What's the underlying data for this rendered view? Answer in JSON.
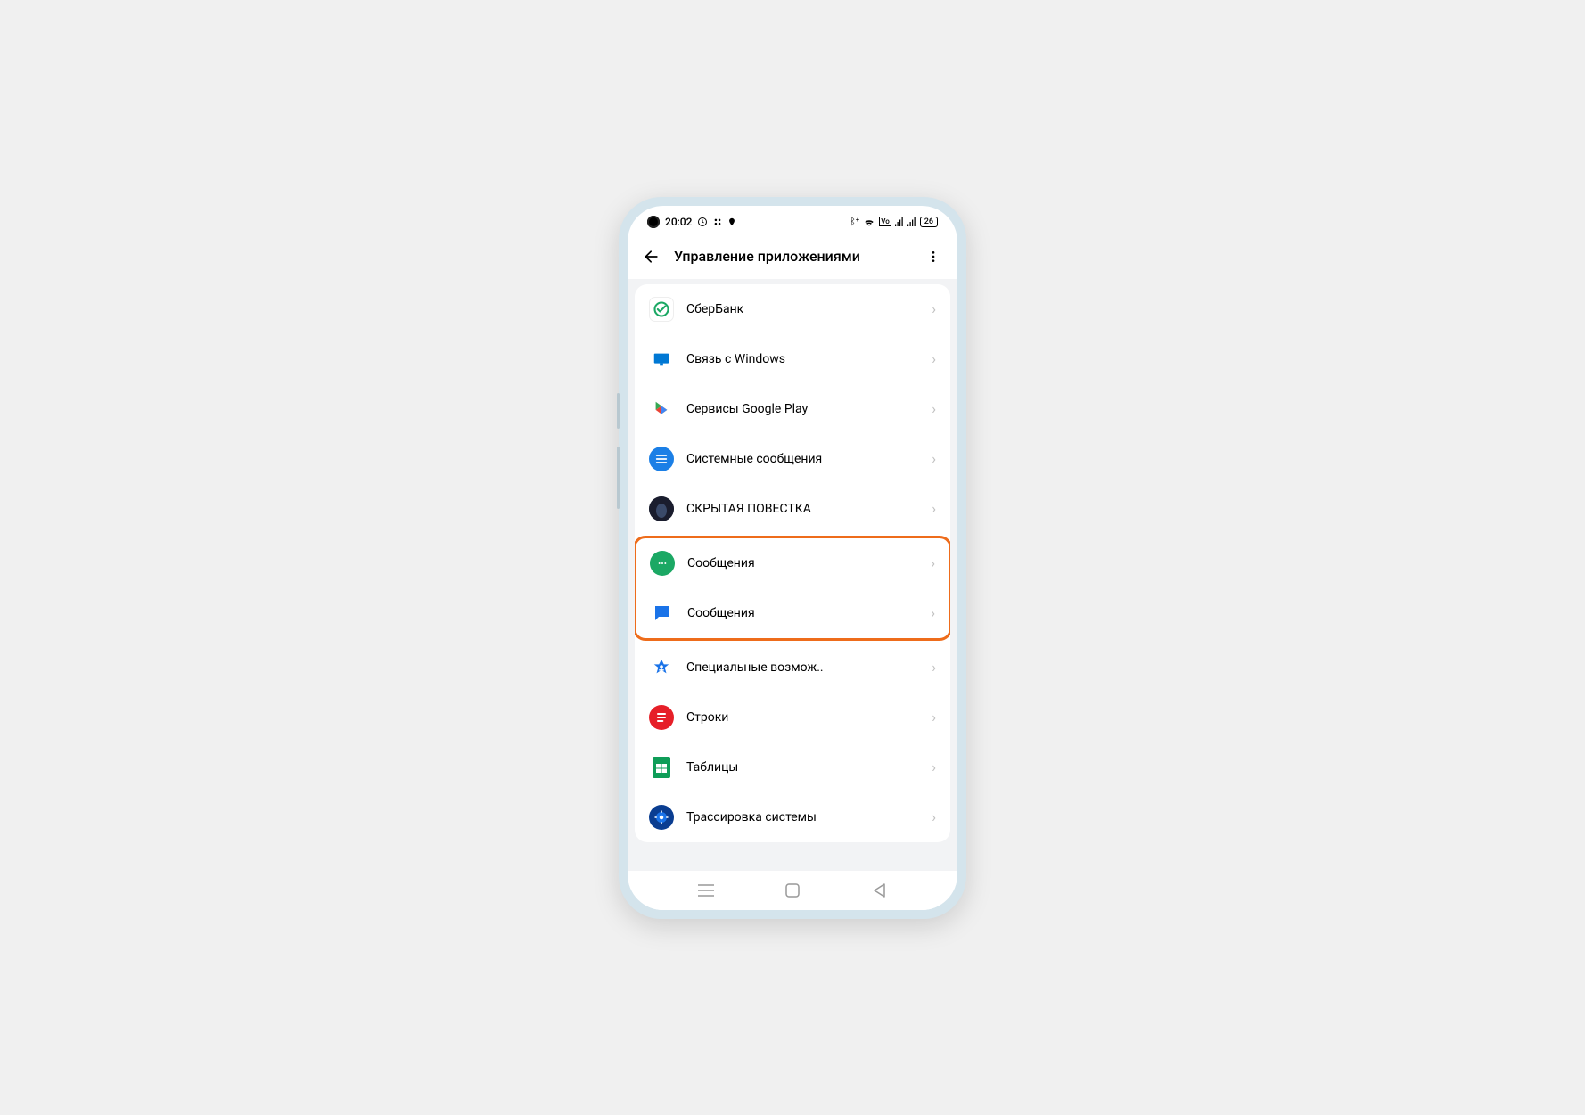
{
  "status": {
    "time": "20:02",
    "battery": "26"
  },
  "header": {
    "title": "Управление приложениями"
  },
  "apps": [
    {
      "label": "СберБанк"
    },
    {
      "label": "Связь с Windows"
    },
    {
      "label": "Сервисы Google Play"
    },
    {
      "label": "Системные сообщения"
    },
    {
      "label": "СКРЫТАЯ ПОВЕСТКА"
    },
    {
      "label": "Сообщения"
    },
    {
      "label": "Сообщения"
    },
    {
      "label": "Специальные возмож.."
    },
    {
      "label": "Строки"
    },
    {
      "label": "Таблицы"
    },
    {
      "label": "Трассировка системы"
    }
  ],
  "highlight_indices": [
    5,
    6
  ]
}
